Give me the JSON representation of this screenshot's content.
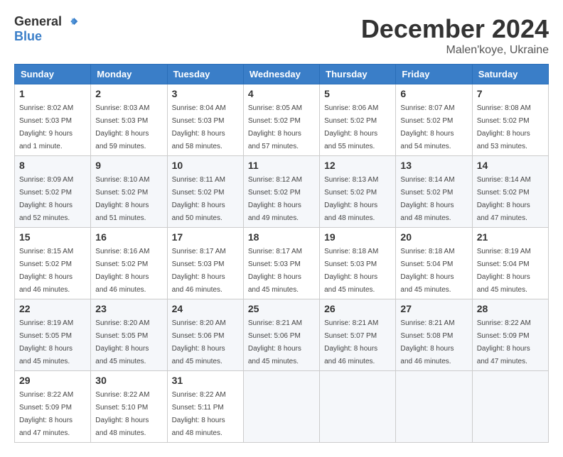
{
  "header": {
    "logo_general": "General",
    "logo_blue": "Blue",
    "month_title": "December 2024",
    "location": "Malen'koye, Ukraine"
  },
  "weekdays": [
    "Sunday",
    "Monday",
    "Tuesday",
    "Wednesday",
    "Thursday",
    "Friday",
    "Saturday"
  ],
  "weeks": [
    [
      {
        "day": "1",
        "sunrise": "8:02 AM",
        "sunset": "5:03 PM",
        "daylight": "9 hours and 1 minute."
      },
      {
        "day": "2",
        "sunrise": "8:03 AM",
        "sunset": "5:03 PM",
        "daylight": "8 hours and 59 minutes."
      },
      {
        "day": "3",
        "sunrise": "8:04 AM",
        "sunset": "5:03 PM",
        "daylight": "8 hours and 58 minutes."
      },
      {
        "day": "4",
        "sunrise": "8:05 AM",
        "sunset": "5:02 PM",
        "daylight": "8 hours and 57 minutes."
      },
      {
        "day": "5",
        "sunrise": "8:06 AM",
        "sunset": "5:02 PM",
        "daylight": "8 hours and 55 minutes."
      },
      {
        "day": "6",
        "sunrise": "8:07 AM",
        "sunset": "5:02 PM",
        "daylight": "8 hours and 54 minutes."
      },
      {
        "day": "7",
        "sunrise": "8:08 AM",
        "sunset": "5:02 PM",
        "daylight": "8 hours and 53 minutes."
      }
    ],
    [
      {
        "day": "8",
        "sunrise": "8:09 AM",
        "sunset": "5:02 PM",
        "daylight": "8 hours and 52 minutes."
      },
      {
        "day": "9",
        "sunrise": "8:10 AM",
        "sunset": "5:02 PM",
        "daylight": "8 hours and 51 minutes."
      },
      {
        "day": "10",
        "sunrise": "8:11 AM",
        "sunset": "5:02 PM",
        "daylight": "8 hours and 50 minutes."
      },
      {
        "day": "11",
        "sunrise": "8:12 AM",
        "sunset": "5:02 PM",
        "daylight": "8 hours and 49 minutes."
      },
      {
        "day": "12",
        "sunrise": "8:13 AM",
        "sunset": "5:02 PM",
        "daylight": "8 hours and 48 minutes."
      },
      {
        "day": "13",
        "sunrise": "8:14 AM",
        "sunset": "5:02 PM",
        "daylight": "8 hours and 48 minutes."
      },
      {
        "day": "14",
        "sunrise": "8:14 AM",
        "sunset": "5:02 PM",
        "daylight": "8 hours and 47 minutes."
      }
    ],
    [
      {
        "day": "15",
        "sunrise": "8:15 AM",
        "sunset": "5:02 PM",
        "daylight": "8 hours and 46 minutes."
      },
      {
        "day": "16",
        "sunrise": "8:16 AM",
        "sunset": "5:02 PM",
        "daylight": "8 hours and 46 minutes."
      },
      {
        "day": "17",
        "sunrise": "8:17 AM",
        "sunset": "5:03 PM",
        "daylight": "8 hours and 46 minutes."
      },
      {
        "day": "18",
        "sunrise": "8:17 AM",
        "sunset": "5:03 PM",
        "daylight": "8 hours and 45 minutes."
      },
      {
        "day": "19",
        "sunrise": "8:18 AM",
        "sunset": "5:03 PM",
        "daylight": "8 hours and 45 minutes."
      },
      {
        "day": "20",
        "sunrise": "8:18 AM",
        "sunset": "5:04 PM",
        "daylight": "8 hours and 45 minutes."
      },
      {
        "day": "21",
        "sunrise": "8:19 AM",
        "sunset": "5:04 PM",
        "daylight": "8 hours and 45 minutes."
      }
    ],
    [
      {
        "day": "22",
        "sunrise": "8:19 AM",
        "sunset": "5:05 PM",
        "daylight": "8 hours and 45 minutes."
      },
      {
        "day": "23",
        "sunrise": "8:20 AM",
        "sunset": "5:05 PM",
        "daylight": "8 hours and 45 minutes."
      },
      {
        "day": "24",
        "sunrise": "8:20 AM",
        "sunset": "5:06 PM",
        "daylight": "8 hours and 45 minutes."
      },
      {
        "day": "25",
        "sunrise": "8:21 AM",
        "sunset": "5:06 PM",
        "daylight": "8 hours and 45 minutes."
      },
      {
        "day": "26",
        "sunrise": "8:21 AM",
        "sunset": "5:07 PM",
        "daylight": "8 hours and 46 minutes."
      },
      {
        "day": "27",
        "sunrise": "8:21 AM",
        "sunset": "5:08 PM",
        "daylight": "8 hours and 46 minutes."
      },
      {
        "day": "28",
        "sunrise": "8:22 AM",
        "sunset": "5:09 PM",
        "daylight": "8 hours and 47 minutes."
      }
    ],
    [
      {
        "day": "29",
        "sunrise": "8:22 AM",
        "sunset": "5:09 PM",
        "daylight": "8 hours and 47 minutes."
      },
      {
        "day": "30",
        "sunrise": "8:22 AM",
        "sunset": "5:10 PM",
        "daylight": "8 hours and 48 minutes."
      },
      {
        "day": "31",
        "sunrise": "8:22 AM",
        "sunset": "5:11 PM",
        "daylight": "8 hours and 48 minutes."
      },
      null,
      null,
      null,
      null
    ]
  ]
}
